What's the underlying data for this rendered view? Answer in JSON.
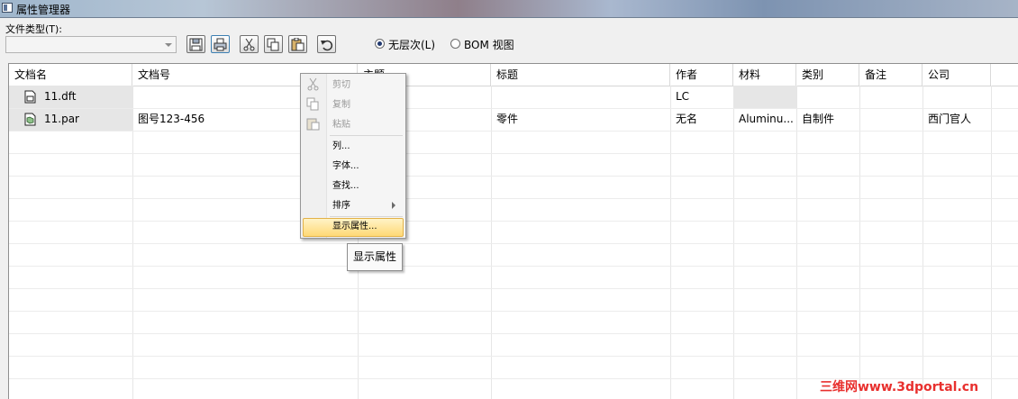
{
  "window": {
    "title": "属性管理器"
  },
  "doc_type": {
    "label": "文件类型(T):",
    "value": ""
  },
  "toolbar": {
    "buttons": [
      "save-icon",
      "print-icon",
      "cut-icon",
      "copy-icon",
      "paste-icon",
      "undo-icon"
    ]
  },
  "view_options": [
    {
      "label": "无层次(L)",
      "selected": true
    },
    {
      "label": "BOM 视图",
      "selected": false
    }
  ],
  "grid": {
    "columns": [
      "文档名",
      "文档号",
      "主题",
      "标题",
      "作者",
      "材料",
      "类别",
      "备注",
      "公司"
    ],
    "rows": [
      {
        "文档名": "11.dft",
        "文档号": "",
        "主题": "",
        "标题": "",
        "作者": "LC",
        "材料": "",
        "类别": "",
        "备注": "",
        "公司": ""
      },
      {
        "文档名": "11.par",
        "文档号": "图号123-456",
        "主题": "",
        "标题": "零件",
        "作者": "无名",
        "材料": "Aluminu...",
        "类别": "自制件",
        "备注": "",
        "公司": "西门官人"
      }
    ]
  },
  "context_menu": {
    "items": [
      {
        "label": "剪切",
        "enabled": false
      },
      {
        "label": "复制",
        "enabled": false
      },
      {
        "label": "粘贴",
        "enabled": false
      },
      {
        "label": "列...",
        "enabled": true
      },
      {
        "label": "字体...",
        "enabled": true
      },
      {
        "label": "查找...",
        "enabled": true
      },
      {
        "label": "排序",
        "enabled": true,
        "submenu": true
      },
      {
        "label": "显示属性...",
        "enabled": true,
        "highlighted": true
      }
    ]
  },
  "tooltip": "显示属性",
  "watermark": "三维网www.3dportal.cn"
}
